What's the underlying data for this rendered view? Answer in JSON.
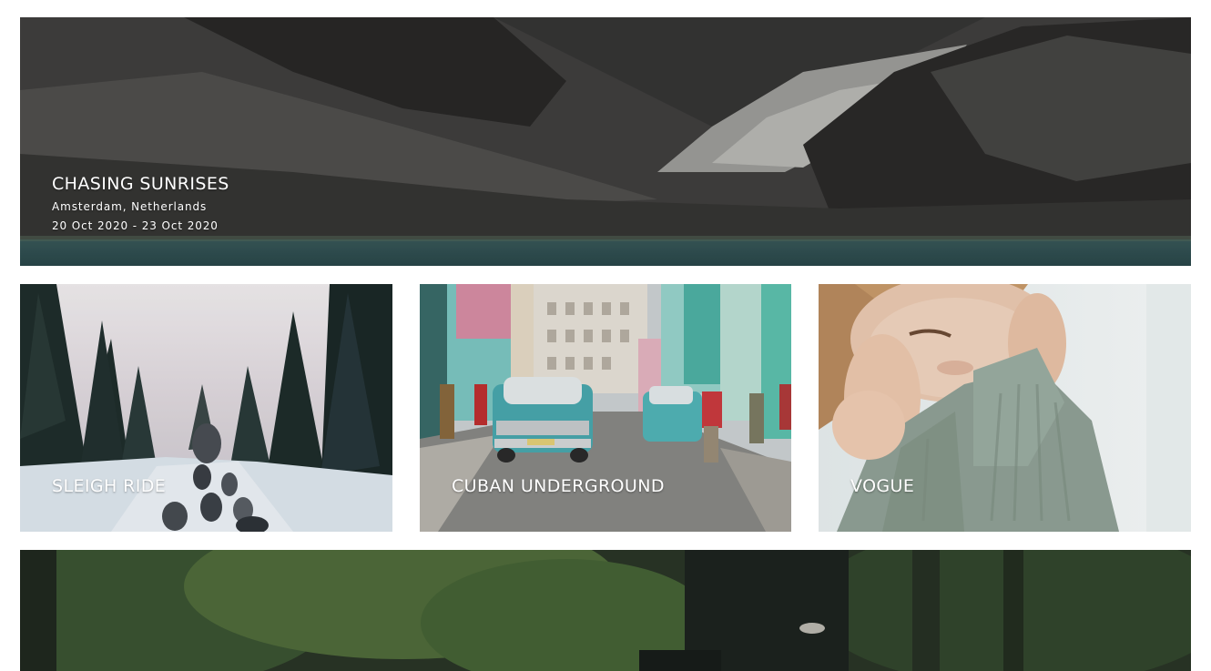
{
  "gallery": {
    "cards": [
      {
        "title": "CHASING SUNRISES",
        "location": "Amsterdam, Netherlands",
        "dates": "20 Oct 2020 - 23 Oct 2020"
      },
      {
        "title": "SLEIGH RIDE"
      },
      {
        "title": "CUBAN UNDERGROUND"
      },
      {
        "title": "VOGUE"
      },
      {
        "title": ""
      }
    ]
  },
  "colors": {
    "caption_text": "#ffffff",
    "background": "#ffffff"
  }
}
